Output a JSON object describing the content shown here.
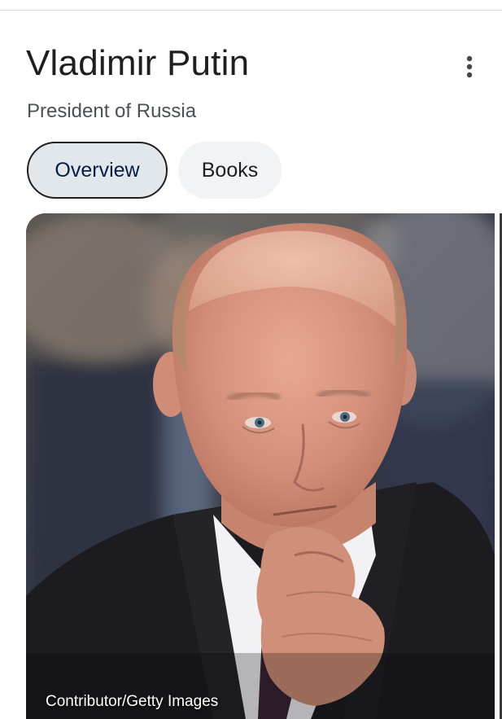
{
  "knowledge_panel": {
    "title": "Vladimir Putin",
    "subtitle": "President of Russia",
    "more_icon": "more-vert-icon",
    "tabs": [
      {
        "label": "Overview",
        "selected": true
      },
      {
        "label": "Books",
        "selected": false
      }
    ],
    "image": {
      "credit": "Contributor/Getty Images"
    }
  },
  "colors": {
    "title_text": "#1f1f1f",
    "subtitle_text": "#4d5156",
    "selected_chip_bg": "#e2e7eb",
    "selected_chip_text": "#041e49",
    "unselected_chip_bg": "#f1f3f4"
  }
}
